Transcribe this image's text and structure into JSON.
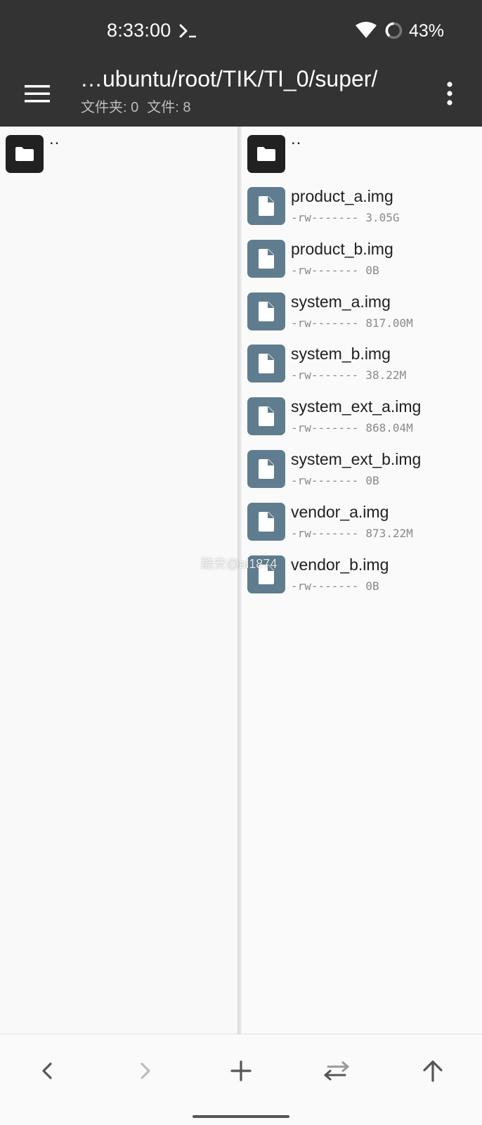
{
  "status_bar": {
    "time": "8:33:00",
    "battery": "43%",
    "icons": [
      "terminal-icon",
      "wifi-icon",
      "battery-ring-icon"
    ]
  },
  "app_bar": {
    "path": "…ubuntu/root/TIK/TI_0/super/",
    "folders_label": "文件夹: 0",
    "files_label": "文件: 8",
    "menu_icon": "hamburger-menu-icon",
    "more_icon": "more-vert-icon"
  },
  "left_pane": {
    "parent_label": ".."
  },
  "right_pane": {
    "parent_label": "..",
    "files": [
      {
        "name": "product_a.img",
        "perms": "-rw-------",
        "size": "3.05G"
      },
      {
        "name": "product_b.img",
        "perms": "-rw-------",
        "size": "0B"
      },
      {
        "name": "system_a.img",
        "perms": "-rw-------",
        "size": "817.00M"
      },
      {
        "name": "system_b.img",
        "perms": "-rw-------",
        "size": "38.22M"
      },
      {
        "name": "system_ext_a.img",
        "perms": "-rw-------",
        "size": "868.04M"
      },
      {
        "name": "system_ext_b.img",
        "perms": "-rw-------",
        "size": "0B"
      },
      {
        "name": "vendor_a.img",
        "perms": "-rw-------",
        "size": "873.22M"
      },
      {
        "name": "vendor_b.img",
        "perms": "-rw-------",
        "size": "0B"
      }
    ]
  },
  "watermark": "酷安@al1874",
  "bottom_bar": {
    "buttons": [
      "back-icon",
      "forward-icon",
      "add-icon",
      "swap-icon",
      "up-icon"
    ]
  },
  "colors": {
    "bar": "#333333",
    "background": "#fafafa",
    "file_thumb": "#5f7d8e",
    "folder_thumb": "#212121",
    "disabled_icon": "#bdbdbd"
  }
}
